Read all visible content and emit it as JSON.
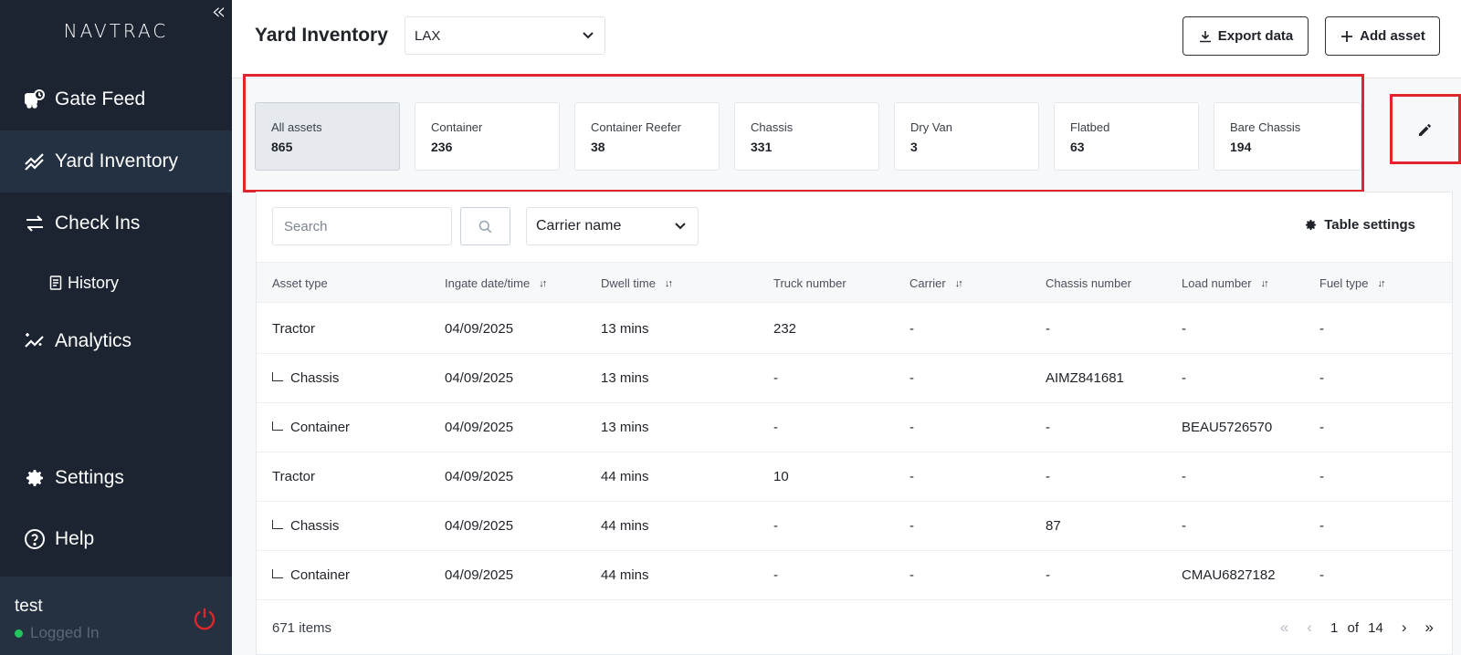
{
  "sidebar": {
    "logo": "NAVTRAC",
    "collapse_icon": "double-chevron-left-icon",
    "items": [
      {
        "label": "Gate Feed",
        "icon": "truck-clock-icon"
      },
      {
        "label": "Yard Inventory",
        "icon": "trend-line-icon",
        "active": true
      },
      {
        "label": "Check Ins",
        "icon": "swap-arrows-icon"
      },
      {
        "label": "History",
        "icon": "receipt-icon",
        "sub": true
      },
      {
        "label": "Analytics",
        "icon": "sparkle-chart-icon"
      }
    ],
    "bottom_items": [
      {
        "label": "Settings",
        "icon": "gear-icon"
      },
      {
        "label": "Help",
        "icon": "question-circle-icon"
      }
    ],
    "user": {
      "name": "test",
      "status": "Logged In"
    }
  },
  "header": {
    "title": "Yard Inventory",
    "location": "LAX",
    "export_label": "Export data",
    "add_label": "Add asset"
  },
  "cards": [
    {
      "label": "All assets",
      "count": "865",
      "active": true
    },
    {
      "label": "Container",
      "count": "236"
    },
    {
      "label": "Container Reefer",
      "count": "38"
    },
    {
      "label": "Chassis",
      "count": "331"
    },
    {
      "label": "Dry Van",
      "count": "3"
    },
    {
      "label": "Flatbed",
      "count": "63"
    },
    {
      "label": "Bare Chassis",
      "count": "194"
    }
  ],
  "toolbar": {
    "search_placeholder": "Search",
    "carrier_select": "Carrier name",
    "table_settings": "Table settings"
  },
  "table": {
    "columns": [
      "Asset type",
      "Ingate date/time",
      "Dwell time",
      "Truck number",
      "Carrier",
      "Chassis number",
      "Load number",
      "Fuel type"
    ],
    "rows": [
      {
        "asset": "Tractor",
        "child": false,
        "date": "04/09/2025",
        "dwell": "13 mins",
        "truck": "232",
        "carrier": "-",
        "chassis": "-",
        "load": "-",
        "fuel": "-"
      },
      {
        "asset": "Chassis",
        "child": true,
        "date": "04/09/2025",
        "dwell": "13 mins",
        "truck": "-",
        "carrier": "-",
        "chassis": "AIMZ841681",
        "load": "-",
        "fuel": "-"
      },
      {
        "asset": "Container",
        "child": true,
        "date": "04/09/2025",
        "dwell": "13 mins",
        "truck": "-",
        "carrier": "-",
        "chassis": "-",
        "load": "BEAU5726570",
        "fuel": "-"
      },
      {
        "asset": "Tractor",
        "child": false,
        "date": "04/09/2025",
        "dwell": "44 mins",
        "truck": "10",
        "carrier": "-",
        "chassis": "-",
        "load": "-",
        "fuel": "-"
      },
      {
        "asset": "Chassis",
        "child": true,
        "date": "04/09/2025",
        "dwell": "44 mins",
        "truck": "-",
        "carrier": "-",
        "chassis": "87",
        "load": "-",
        "fuel": "-"
      },
      {
        "asset": "Container",
        "child": true,
        "date": "04/09/2025",
        "dwell": "44 mins",
        "truck": "-",
        "carrier": "-",
        "chassis": "-",
        "load": "CMAU6827182",
        "fuel": "-"
      }
    ]
  },
  "footer": {
    "items_count": "671 items",
    "page_current": "1",
    "page_of": "of",
    "page_total": "14"
  },
  "colors": {
    "sidebar_bg": "#1b2430",
    "highlight_red": "#e0262c",
    "status_green": "#21c45d",
    "power_red": "#e0262c"
  }
}
